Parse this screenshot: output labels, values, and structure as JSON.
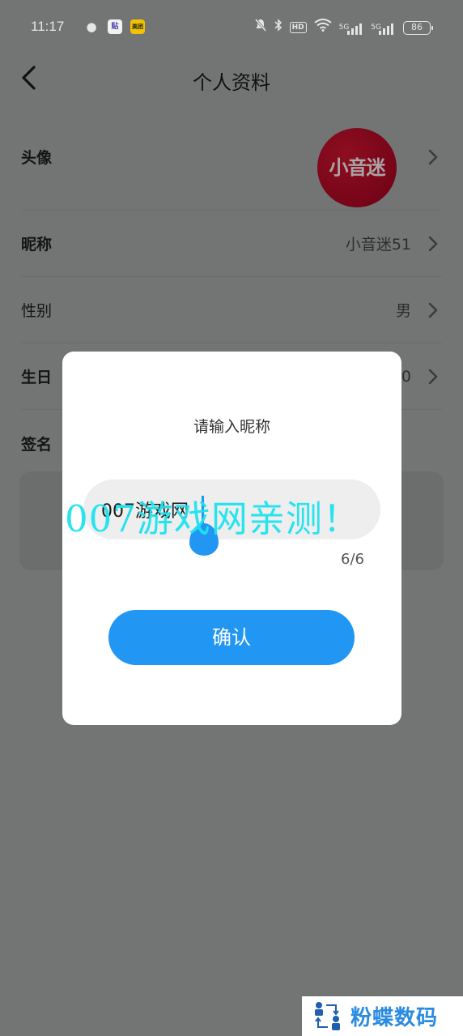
{
  "status_bar": {
    "time": "11:17",
    "notification_apps": [
      "wechat-icon",
      "tieba-icon",
      "meituan-icon"
    ],
    "tieba_label": "贴",
    "meituan_label": "美团",
    "right_icons": [
      "mute-icon",
      "bluetooth-icon",
      "hd-icon",
      "wifi-icon",
      "signal-5g-icon",
      "signal-5g-icon",
      "battery-icon"
    ],
    "hd_label": "HD",
    "network_label": "5G",
    "battery_level": "86"
  },
  "header": {
    "title": "个人资料",
    "back_icon": "chevron-left-icon"
  },
  "profile_rows": [
    {
      "label": "头像",
      "value": "",
      "avatar_text": "小音迷"
    },
    {
      "label": "昵称",
      "value": "小音迷51"
    },
    {
      "label": "性别",
      "value": "男"
    },
    {
      "label": "生日",
      "value": "0"
    },
    {
      "label": "签名",
      "value": ""
    }
  ],
  "dialog": {
    "title": "请输入昵称",
    "input_value": "007游戏网",
    "input_placeholder": "",
    "counter": "6/6",
    "confirm_label": "确认"
  },
  "overlay_watermark": "007游戏网亲测！",
  "brand_badge": {
    "text": "粉蝶数码"
  },
  "colors": {
    "accent": "#2196f3",
    "overlay": "#737474",
    "watermark": "#1ee3ee",
    "avatar": "#7d0a1c"
  }
}
